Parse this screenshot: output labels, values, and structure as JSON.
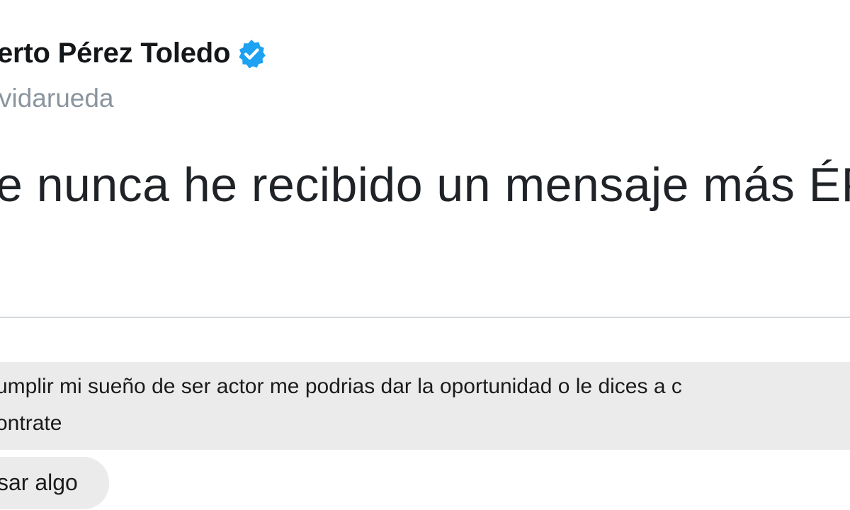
{
  "tweet": {
    "display_name": "erto Pérez Toledo",
    "verified_icon": "verified-badge-icon",
    "handle": "vidarueda",
    "text": "e nunca he recibido un mensaje más ÉP"
  },
  "message": {
    "line1": "umplir mi sueño de ser actor me podrias dar la oportunidad o le dices a c",
    "line2": "ontrate",
    "reply": "sar algo"
  },
  "colors": {
    "verified_blue": "#1da1f2",
    "bubble_gray": "#ebebeb",
    "handle_gray": "#8a959f"
  }
}
